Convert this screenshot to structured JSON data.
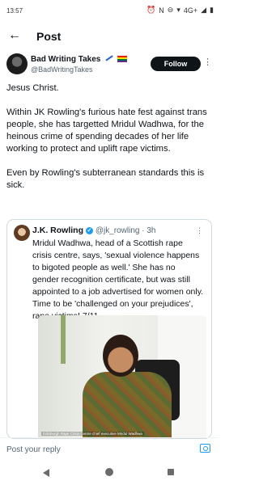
{
  "status_bar": {
    "time": "13:57",
    "icons": [
      "alarm-icon",
      "n-icon",
      "dnd-icon",
      "wifi-icon",
      "signal-icon",
      "battery-icon"
    ],
    "net_label": "4G+"
  },
  "header": {
    "title": "Post",
    "back_icon": "back-arrow-icon"
  },
  "post": {
    "author_name": "Bad Writing Takes",
    "author_handle": "@BadWritingTakes",
    "follow_label": "Follow",
    "paragraphs": [
      "Jesus Christ.",
      "Within JK Rowling's furious hate fest against trans people, she has targetted Mridul Wadhwa, for the heinous crime of spending decades of her life working to protect and uplift rape victims.",
      "Even by Rowling's subterranean standards this is sick."
    ]
  },
  "quote": {
    "name": "J.K. Rowling",
    "handle_time": "@jk_rowling · 3h",
    "text": "Mridul Wadhwa, head of a Scottish rape crisis centre, says, 'sexual violence happens to bigoted people as well.' She has no gender recognition certificate, but was still appointed to a job advertised for women only. Time to be 'challenged on your prejudices', rape victims! 7/11",
    "image_caption": "Edinburgh Rape Crisis Centre chief executive Mridul Wadhwa"
  },
  "reply": {
    "placeholder": "Post your reply"
  },
  "colors": {
    "accent": "#1d9bf0",
    "follow_bg": "#0f1419",
    "text": "#0f1419",
    "muted": "#536471"
  }
}
